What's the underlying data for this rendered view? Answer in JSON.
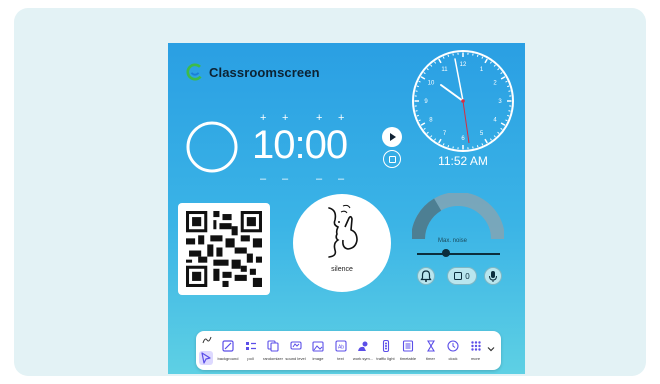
{
  "brand": {
    "name": "Classroomscreen"
  },
  "timer": {
    "value": "10:00",
    "plus": "+",
    "minus": "–"
  },
  "clock": {
    "digital": "11:52 AM",
    "numbers": [
      "12",
      "1",
      "2",
      "3",
      "4",
      "5",
      "6",
      "7",
      "8",
      "9",
      "10",
      "11"
    ]
  },
  "silence": {
    "label": "silence"
  },
  "noise": {
    "label": "Max. noise",
    "count": "0",
    "level_fraction": 0.33
  },
  "toolbar": {
    "tools": [
      {
        "name": "background",
        "label": "background"
      },
      {
        "name": "poll",
        "label": "poll"
      },
      {
        "name": "randomizer",
        "label": "randomizer"
      },
      {
        "name": "sound-level",
        "label": "sound level"
      },
      {
        "name": "image",
        "label": "image"
      },
      {
        "name": "text",
        "label": "text"
      },
      {
        "name": "work-symbols",
        "label": "work sym..."
      },
      {
        "name": "traffic-light",
        "label": "traffic light"
      },
      {
        "name": "timetable",
        "label": "timetable"
      },
      {
        "name": "timer",
        "label": "timer"
      },
      {
        "name": "clock",
        "label": "clock"
      },
      {
        "name": "more",
        "label": "more"
      }
    ]
  },
  "colors": {
    "screen_top": "#2a9fe3",
    "screen_bottom": "#5ed0e4",
    "card": "#e3f2f5",
    "brand_green": "#3dbb4a",
    "accent_purple": "#5b4ee8"
  }
}
